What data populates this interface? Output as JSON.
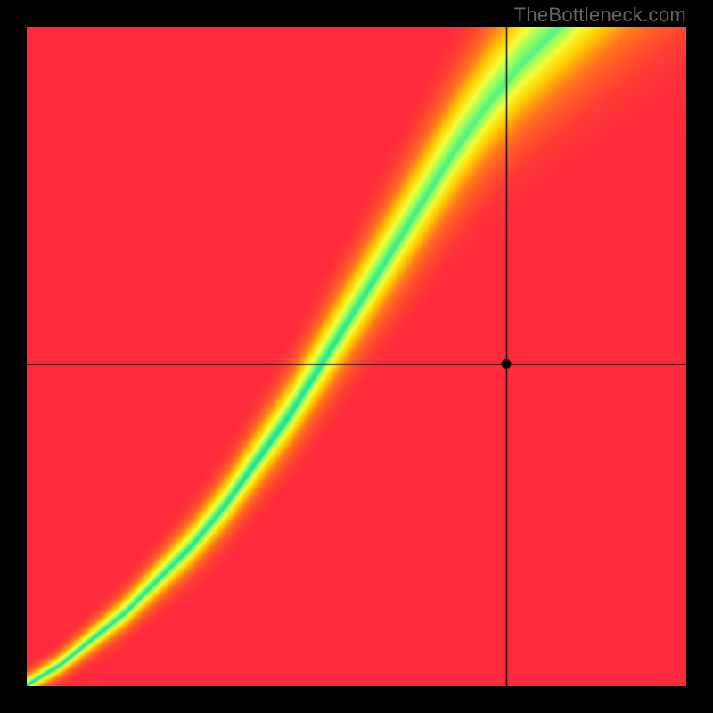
{
  "watermark": "TheBottleneck.com",
  "chart_data": {
    "type": "heatmap",
    "title": "",
    "xlabel": "",
    "ylabel": "",
    "xlim": [
      0,
      1
    ],
    "ylim": [
      0,
      1
    ],
    "grid": false,
    "marker": {
      "x": 0.728,
      "y": 0.488
    },
    "crosshair": {
      "x": 0.728,
      "y": 0.488
    },
    "optimal_curve": {
      "description": "green ridge path from bottom-left to top-right, superlinear",
      "points": [
        {
          "x": 0.0,
          "y": 0.0
        },
        {
          "x": 0.05,
          "y": 0.03
        },
        {
          "x": 0.1,
          "y": 0.07
        },
        {
          "x": 0.15,
          "y": 0.11
        },
        {
          "x": 0.2,
          "y": 0.16
        },
        {
          "x": 0.25,
          "y": 0.21
        },
        {
          "x": 0.3,
          "y": 0.27
        },
        {
          "x": 0.35,
          "y": 0.34
        },
        {
          "x": 0.4,
          "y": 0.41
        },
        {
          "x": 0.45,
          "y": 0.49
        },
        {
          "x": 0.5,
          "y": 0.57
        },
        {
          "x": 0.55,
          "y": 0.65
        },
        {
          "x": 0.6,
          "y": 0.73
        },
        {
          "x": 0.65,
          "y": 0.81
        },
        {
          "x": 0.7,
          "y": 0.88
        },
        {
          "x": 0.75,
          "y": 0.94
        },
        {
          "x": 0.8,
          "y": 0.99
        }
      ]
    },
    "color_scale": {
      "stops": [
        {
          "t": 0.0,
          "color": "#ff2a3c"
        },
        {
          "t": 0.35,
          "color": "#ff7a1a"
        },
        {
          "t": 0.6,
          "color": "#ffd000"
        },
        {
          "t": 0.8,
          "color": "#f4ff3a"
        },
        {
          "t": 0.92,
          "color": "#8cff66"
        },
        {
          "t": 1.0,
          "color": "#18e29a"
        }
      ]
    }
  }
}
